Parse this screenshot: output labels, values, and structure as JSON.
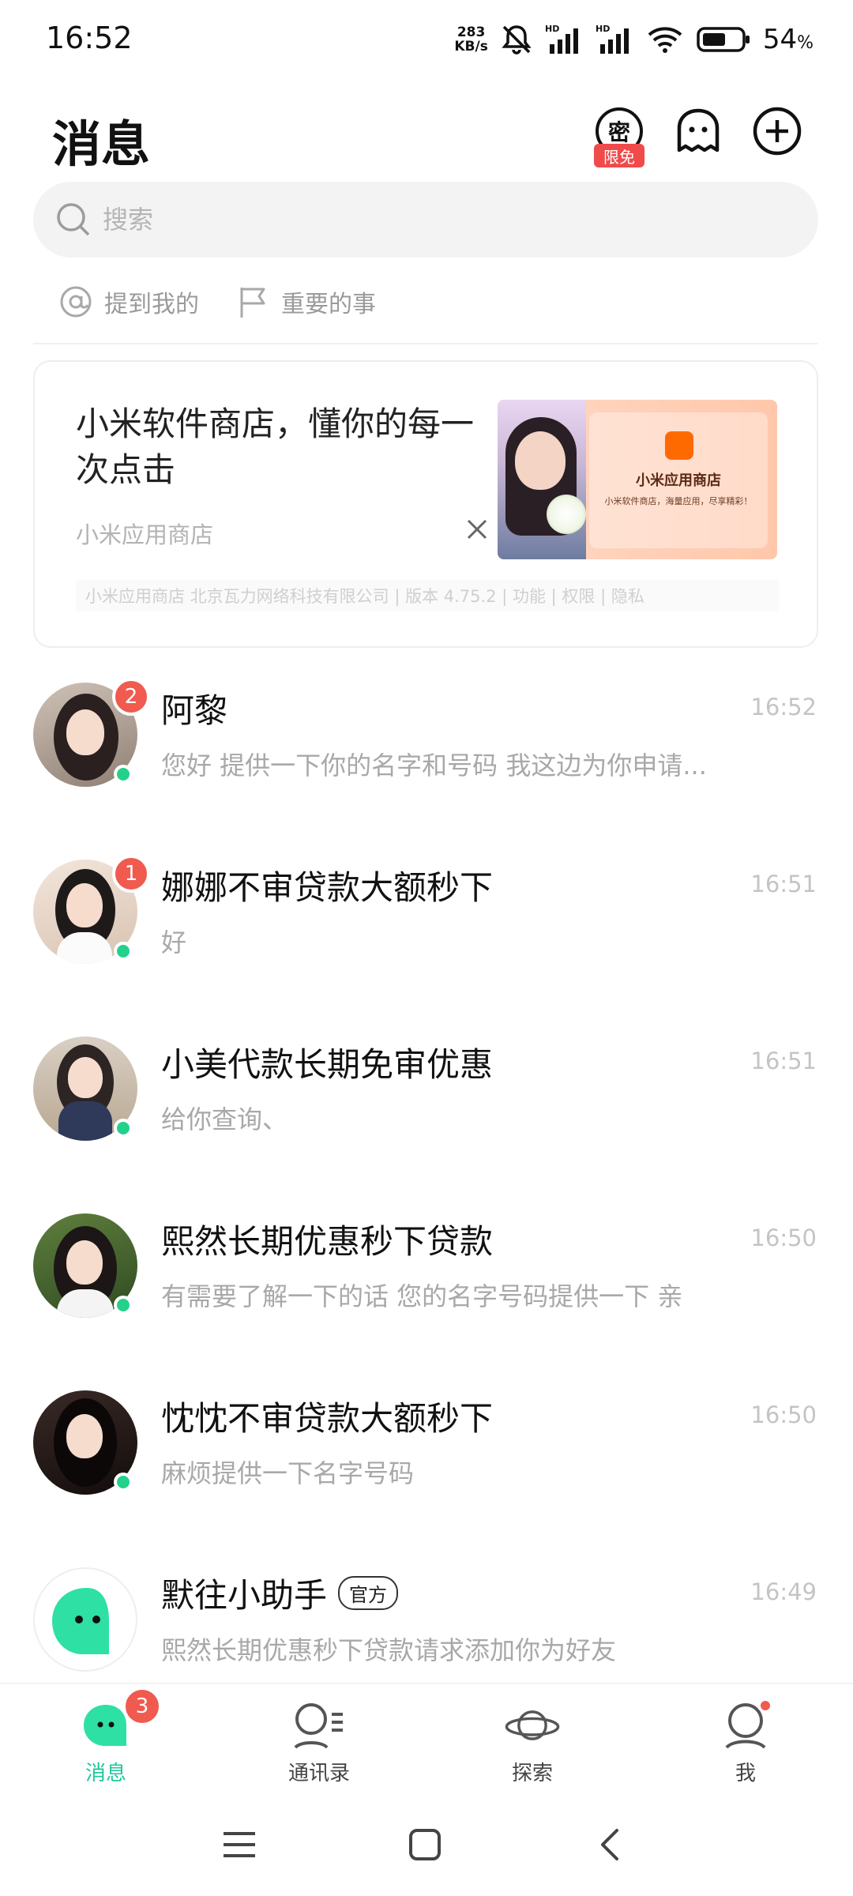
{
  "status_bar": {
    "time": "16:52",
    "speed_value": "283",
    "speed_unit": "KB/s",
    "battery_percent": "54",
    "battery_unit": "%"
  },
  "header": {
    "title": "消息",
    "secret_label": "密",
    "free_badge": "限免"
  },
  "search": {
    "placeholder": "搜索"
  },
  "filters": {
    "mentions": "提到我的",
    "important": "重要的事"
  },
  "ad": {
    "title": "小米软件商店，懂你的每一次点击",
    "source": "小米应用商店",
    "image_app_name": "小米应用商店",
    "image_app_desc": "小米软件商店，海量应用，尽享精彩！",
    "footer": "小米应用商店 北京瓦力网络科技有限公司 | 版本 4.75.2 | 功能 | 权限 | 隐私"
  },
  "chats": [
    {
      "name": "阿黎",
      "time": "16:52",
      "preview": "您好 提供一下你的名字和号码 我这边为你申请...",
      "unread": "2"
    },
    {
      "name": "娜娜不审贷款大额秒下",
      "time": "16:51",
      "preview": "好",
      "unread": "1"
    },
    {
      "name": "小美代款长期免审优惠",
      "time": "16:51",
      "preview": "给你查询、",
      "unread": ""
    },
    {
      "name": "熙然长期优惠秒下贷款",
      "time": "16:50",
      "preview": "有需要了解一下的话 您的名字号码提供一下 亲",
      "unread": ""
    },
    {
      "name": "忱忱不审贷款大额秒下",
      "time": "16:50",
      "preview": "麻烦提供一下名字号码",
      "unread": ""
    },
    {
      "name": "默往小助手",
      "tag": "官方",
      "time": "16:49",
      "preview": "熙然长期优惠秒下贷款请求添加你为好友",
      "unread": ""
    }
  ],
  "bottom_nav": {
    "messages": "消息",
    "messages_badge": "3",
    "contacts": "通讯录",
    "explore": "探索",
    "me": "我"
  },
  "colors": {
    "accent": "#1fc69b",
    "badge": "#f05a4f",
    "online": "#23d18b"
  }
}
